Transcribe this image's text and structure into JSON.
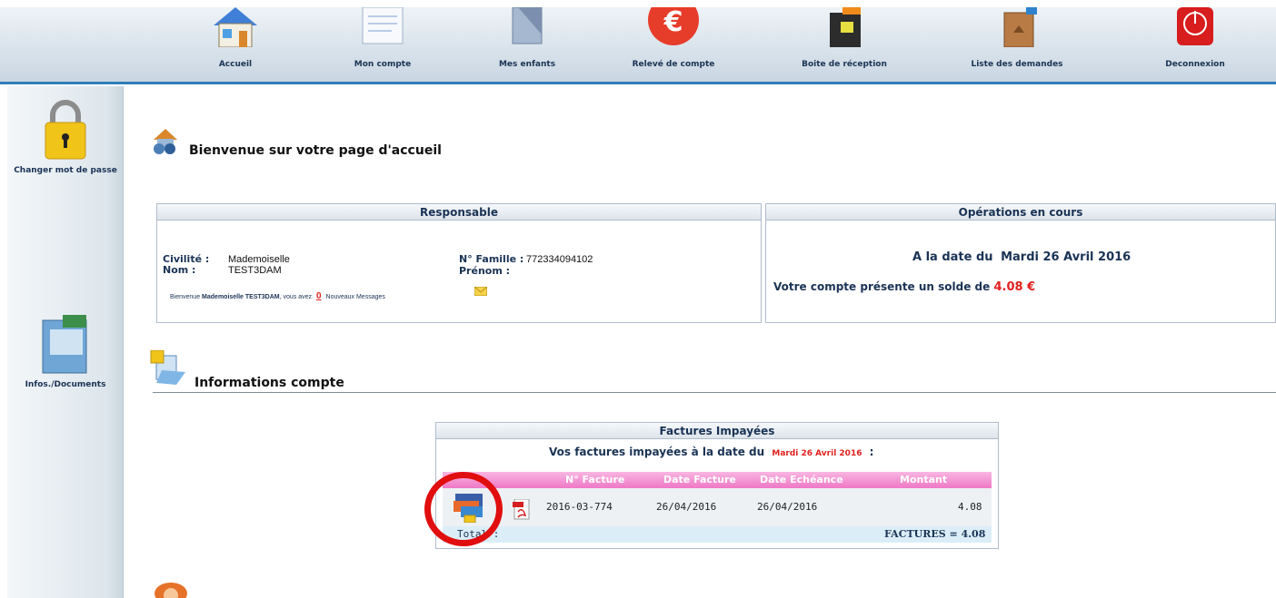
{
  "nav": {
    "items": [
      {
        "label": "Accueil",
        "icon": "home-icon"
      },
      {
        "label": "Mon compte",
        "icon": "account-icon"
      },
      {
        "label": "Mes enfants",
        "icon": "children-icon"
      },
      {
        "label": "Relevé de compte",
        "icon": "euro-icon"
      },
      {
        "label": "Boite de réception",
        "icon": "inbox-icon"
      },
      {
        "label": "Liste des demandes",
        "icon": "requests-box-icon"
      },
      {
        "label": "Deconnexion",
        "icon": "power-icon"
      }
    ]
  },
  "sidebar": {
    "items": [
      {
        "label": "Changer mot de passe",
        "icon": "padlock-icon"
      },
      {
        "label": "Infos./Documents",
        "icon": "documents-icon"
      }
    ]
  },
  "welcome": {
    "title": "Bienvenue sur votre page d'accueil"
  },
  "responsable": {
    "header": "Responsable",
    "civilite_label": "Civilité :",
    "civilite_value": "Mademoiselle",
    "nom_label": "Nom :",
    "nom_value": "TEST3DAM",
    "famille_label": "N° Famille :",
    "famille_value": "772334094102",
    "prenom_label": "Prénom :",
    "msg_prefix": "Bienvenue",
    "msg_name": "Mademoiselle TEST3DAM",
    "msg_mid": ", vous avez",
    "msg_count": "0",
    "msg_suffix": "Nouveaux Messages"
  },
  "operations": {
    "header": "Opérations en cours",
    "date_prefix": "A la date du",
    "date_value": "Mardi 26 Avril 2016",
    "solde_prefix": "Votre compte présente un solde de",
    "solde_value": "4.08 €"
  },
  "account_section": {
    "title": "Informations compte"
  },
  "factures": {
    "header": "Factures Impayées",
    "subtitle_prefix": "Vos factures impayées à la date du",
    "subtitle_date": "Mardi 26 Avril 2016",
    "subtitle_suffix": ":",
    "columns": [
      "N° Facture",
      "Date Facture",
      "Date Echéance",
      "Montant"
    ],
    "row": {
      "numero": "2016-03-774",
      "date_facture": "26/04/2016",
      "date_echeance": "26/04/2016",
      "montant": "4.08"
    },
    "total_label": "Total :",
    "total_value": "FACTURES = 4.08"
  },
  "colors": {
    "accent_red": "#e0201e",
    "nav_blue": "#1a3355",
    "table_pink": "#f07ac8"
  }
}
